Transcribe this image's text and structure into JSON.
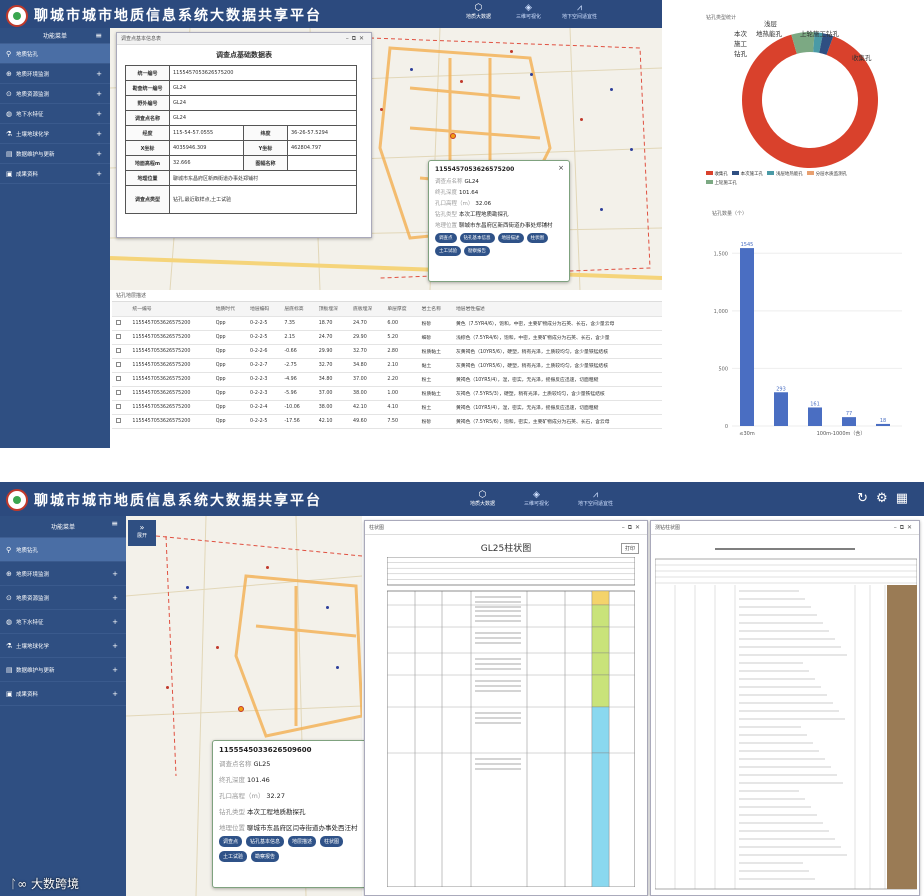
{
  "app": {
    "title": "聊城市城市地质信息系统大数据共享平台"
  },
  "nav": [
    {
      "label": "地质大数据",
      "icon": "cube-network-icon"
    },
    {
      "label": "三维可视化",
      "icon": "cube-icon"
    },
    {
      "label": "地下空间适宜性",
      "icon": "chart-icon"
    }
  ],
  "header_icons": [
    "refresh-icon",
    "gear-icon",
    "apps-icon"
  ],
  "sidebar": {
    "title": "功能菜单",
    "expand_label": "展开",
    "items": [
      {
        "label": "地质钻孔"
      },
      {
        "label": "地质环境监测"
      },
      {
        "label": "地质资源监测"
      },
      {
        "label": "地下水特征"
      },
      {
        "label": "土壤地球化学"
      },
      {
        "label": "数据维护与更新"
      },
      {
        "label": "成果资料"
      }
    ]
  },
  "survey_panel": {
    "title": "调查点基本信息表",
    "heading": "调查点基础数据表",
    "rows": [
      {
        "k": "统一编号",
        "v": "1155457053626575200"
      },
      {
        "k": "勘查统一编号",
        "v": "GL24"
      },
      {
        "k": "野外编号",
        "v": "GL24"
      },
      {
        "k": "调查点名称",
        "v": "GL24"
      }
    ],
    "pair_rows": [
      {
        "k1": "经度",
        "v1": "115-54-57.0555",
        "k2": "纬度",
        "v2": "36-26-57.5294"
      },
      {
        "k1": "X坐标",
        "v1": "4035946.309",
        "k2": "Y坐标",
        "v2": "462804.797"
      },
      {
        "k1": "地面高程m",
        "v1": "32.666",
        "k2": "图幅名称",
        "v2": ""
      }
    ],
    "tail_rows": [
      {
        "k": "地理位置",
        "v": "聊城市东昌府区新西街道办事处郑铺村"
      },
      {
        "k": "调查点类型",
        "v": "钻孔,最近取样点,土工试验"
      }
    ]
  },
  "popup1": {
    "id": "1155457053626575200",
    "rows": [
      {
        "k": "调查点名称",
        "v": "GL24"
      },
      {
        "k": "终孔深度",
        "v": "101.64"
      },
      {
        "k": "孔口高程（m）",
        "v": "32.06"
      },
      {
        "k": "钻孔类型",
        "v": "本次工程地质勘探孔"
      },
      {
        "k": "地理位置",
        "v": "聊城市东昌府区新西街道办事处郑铺村"
      }
    ],
    "buttons": [
      "调查点",
      "钻孔基本信息",
      "地层描述",
      "柱状图",
      "土工试验",
      "勘察报告"
    ]
  },
  "popup2": {
    "id": "1155545033626509600",
    "rows": [
      {
        "k": "调查点名称",
        "v": "GL25"
      },
      {
        "k": "终孔深度",
        "v": "101.46"
      },
      {
        "k": "孔口高程（m）",
        "v": "32.27"
      },
      {
        "k": "钻孔类型",
        "v": "本次工程地质勘探孔"
      },
      {
        "k": "地理位置",
        "v": "聊城市东昌府区闫寺街道办事处西汪村"
      }
    ],
    "buttons": [
      "调查点",
      "钻孔基本信息",
      "地层描述",
      "柱状图",
      "土工试验",
      "勘察报告"
    ]
  },
  "strata_table": {
    "title": "钻孔地层描述",
    "headers": [
      "",
      "统一编号",
      "地质时代",
      "地层编码",
      "层底标高",
      "顶板埋深",
      "底板埋深",
      "单层厚度",
      "岩土名称",
      "地层岩性描述"
    ],
    "rows": [
      [
        "1155457053626575200",
        "Qpp",
        "0-2-2-5",
        "7.35",
        "18.70",
        "24.70",
        "6.00",
        "粉砂",
        "黄色（7.5YR4/6），饱和，中密，主要矿物成分为石英、长石，含少量云母"
      ],
      [
        "1155457053626575200",
        "Qpp",
        "0-2-2-5",
        "2.15",
        "24.70",
        "29.90",
        "5.20",
        "细砂",
        "浅棕色（7.5YR4/6），饱和，中密，主要矿物成分为石英、长石，含少量"
      ],
      [
        "1155457053626575200",
        "Qpp",
        "0-2-2-6",
        "-0.66",
        "29.90",
        "32.70",
        "2.80",
        "粉质黏土",
        "灰黄褐色（10YR5/6），硬塑，稍有光泽，土质较均匀，含少量铁锰结核"
      ],
      [
        "1155457053626575200",
        "Qpp",
        "0-2-2-7",
        "-2.75",
        "32.70",
        "34.80",
        "2.10",
        "黏土",
        "灰黄褐色（10YR5/6），硬塑，稍有光泽，土质较均匀，含少量铁锰结核"
      ],
      [
        "1155457053626575200",
        "Qpp",
        "0-2-2-3",
        "-4.96",
        "34.80",
        "37.00",
        "2.20",
        "粉土",
        "黄褐色（10YR5/4），湿，密实，无光泽，摇振反应迅速，切面粗糙"
      ],
      [
        "1155457053626575200",
        "Qpp",
        "0-2-2-3",
        "-5.96",
        "37.00",
        "38.00",
        "1.00",
        "粉质黏土",
        "灰褐色（7.5YR5/3），硬塑，稍有光泽，土质较均匀，含少量铁锰结核"
      ],
      [
        "1155457053626575200",
        "Qpp",
        "0-2-2-4",
        "-10.06",
        "38.00",
        "42.10",
        "4.10",
        "粉土",
        "黄褐色（10YR5/4），湿，密实，无光泽，摇振反应迅速，切面粗糙"
      ],
      [
        "1155457053626575200",
        "Qpp",
        "0-2-2-5",
        "-17.56",
        "42.10",
        "49.60",
        "7.50",
        "粉砂",
        "黄褐色（7.5YR5/6），饱和，密实，主要矿物成分为石英、长石，含云母"
      ]
    ]
  },
  "donut_chart": {
    "title": "钻孔类型统计",
    "slices": [
      {
        "name": "收集孔",
        "pct": 90,
        "color": "#d9412c"
      },
      {
        "name": "本次施工钻孔",
        "pct": 2.5,
        "color": "#2f4f82"
      },
      {
        "name": "浅层地热能孔",
        "pct": 2,
        "color": "#4a9aa6"
      },
      {
        "name": "上轮施工钻孔",
        "pct": 5.5,
        "color": "#7ca983"
      }
    ],
    "labels": [
      {
        "text": "浅层",
        "pos": "top"
      },
      {
        "text": "地热能孔",
        "pos": "top"
      },
      {
        "text": "本次",
        "pos": "left"
      },
      {
        "text": "施工",
        "pos": "left"
      },
      {
        "text": "钻孔",
        "pos": "left"
      },
      {
        "text": "上轮施工钻孔",
        "pos": "top-right"
      },
      {
        "text": "收集孔",
        "pos": "right"
      }
    ],
    "legend": [
      "收集孔",
      "本次施工孔",
      "浅层地热能孔",
      "分层水质监测孔",
      "上轮施工孔"
    ]
  },
  "chart_data": {
    "type": "bar",
    "title": "钻孔数量（个）",
    "categories": [
      "≤30m",
      "",
      "",
      "100m-1000m（含）",
      ""
    ],
    "values": [
      1545,
      293,
      161,
      77,
      18
    ],
    "yticks": [
      1500,
      1000,
      500,
      0
    ],
    "yticks_labels": [
      "1,500",
      "1,000",
      "500",
      "0"
    ],
    "ylim": [
      0,
      1650
    ],
    "color": "#4a6ec2"
  },
  "column_panel": {
    "title": "柱状图",
    "heading": "GL25柱状图",
    "print": "打印"
  },
  "design_panel": {
    "title": "测钻柱状图"
  },
  "watermark": "大数跨境"
}
